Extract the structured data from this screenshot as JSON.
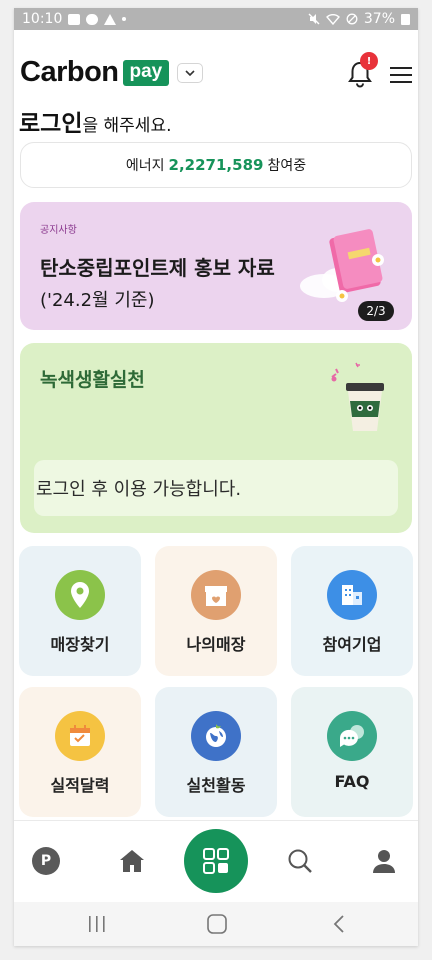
{
  "status_bar": {
    "time": "10:10",
    "battery": "37%",
    "icons": [
      "image-icon",
      "message-icon",
      "warning-icon",
      "dot-icon",
      "mute-icon",
      "wifi-icon",
      "no-signal-icon",
      "battery-icon"
    ]
  },
  "header": {
    "logo_text": "Carbon",
    "logo_badge": "pay",
    "notification_badge": "!",
    "icons": [
      "chevron-down-icon",
      "bell-icon",
      "hamburger-menu-icon"
    ]
  },
  "login": {
    "title": "로그인",
    "suffix": "을 해주세요."
  },
  "energy": {
    "prefix": "에너지",
    "count": "2,2271,589",
    "suffix": "참여중"
  },
  "notice": {
    "tag": "공지사항",
    "title": "탄소중립포인트제 홍보 자료",
    "subtitle": "('24.2월 기준)",
    "pager": "2/3"
  },
  "green_life": {
    "title": "녹색생활실천",
    "message": "로그인 후 이용 가능합니다."
  },
  "menu_tiles": [
    {
      "label": "매장찾기",
      "icon": "map-pin-icon",
      "color": "#8bc34a"
    },
    {
      "label": "나의매장",
      "icon": "store-icon",
      "color": "#e0a070"
    },
    {
      "label": "참여기업",
      "icon": "building-icon",
      "color": "#3d8fe6"
    },
    {
      "label": "실적달력",
      "icon": "calendar-icon",
      "color": "#f5c342"
    },
    {
      "label": "실천활동",
      "icon": "globe-icon",
      "color": "#3f72c8"
    },
    {
      "label": "FAQ",
      "icon": "chat-bubble-icon",
      "color": "#3aa98a"
    }
  ],
  "tab_bar": {
    "point_label": "P",
    "icons": [
      "point-icon",
      "home-icon",
      "grid-icon",
      "search-icon",
      "profile-icon"
    ]
  },
  "colors": {
    "brand_green": "#16935a",
    "badge_red": "#e8323a",
    "notice_bg": "#ecd4ee",
    "green_bg": "#dcf0c6"
  }
}
